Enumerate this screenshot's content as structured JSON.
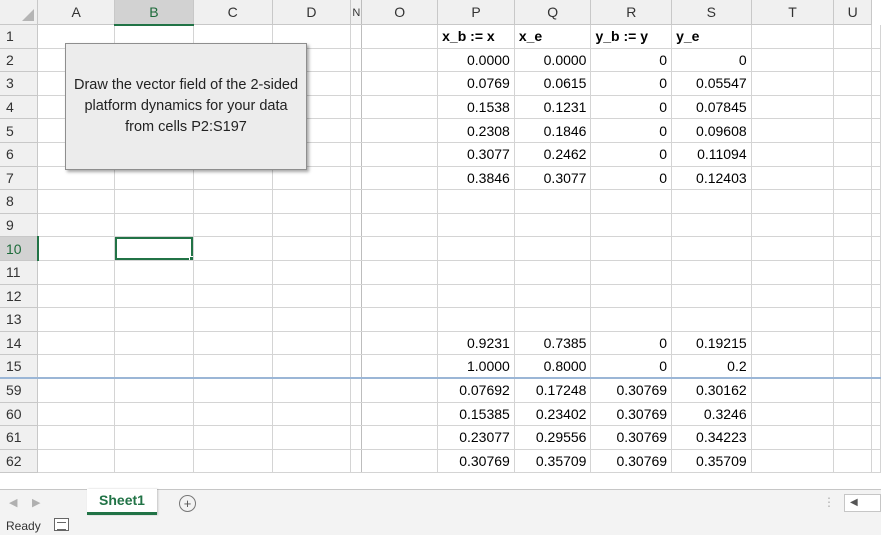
{
  "columns": [
    "A",
    "B",
    "C",
    "D",
    "N",
    "O",
    "P",
    "Q",
    "R",
    "S",
    "T",
    "U"
  ],
  "rows": [
    {
      "num": "1",
      "P": "x_b := x",
      "Q": "x_e",
      "R": "y_b := y",
      "S": "y_e",
      "header": true
    },
    {
      "num": "2",
      "P": "0.0000",
      "Q": "0.0000",
      "R": "0",
      "S": "0"
    },
    {
      "num": "3",
      "P": "0.0769",
      "Q": "0.0615",
      "R": "0",
      "S": "0.05547"
    },
    {
      "num": "4",
      "P": "0.1538",
      "Q": "0.1231",
      "R": "0",
      "S": "0.07845"
    },
    {
      "num": "5",
      "P": "0.2308",
      "Q": "0.1846",
      "R": "0",
      "S": "0.09608"
    },
    {
      "num": "6",
      "P": "0.3077",
      "Q": "0.2462",
      "R": "0",
      "S": "0.11094"
    },
    {
      "num": "7",
      "P": "0.3846",
      "Q": "0.3077",
      "R": "0",
      "S": "0.12403"
    },
    {
      "num": "8",
      "P": "",
      "Q": "",
      "R": "",
      "S": ""
    },
    {
      "num": "9",
      "P": "",
      "Q": "",
      "R": "",
      "S": ""
    },
    {
      "num": "10",
      "P": "",
      "Q": "",
      "R": "",
      "S": ""
    },
    {
      "num": "11",
      "P": "",
      "Q": "",
      "R": "",
      "S": ""
    },
    {
      "num": "12",
      "P": "",
      "Q": "",
      "R": "",
      "S": ""
    },
    {
      "num": "13",
      "P": "",
      "Q": "",
      "R": "",
      "S": ""
    },
    {
      "num": "14",
      "P": "0.9231",
      "Q": "0.7385",
      "R": "0",
      "S": "0.19215"
    },
    {
      "num": "15",
      "P": "1.0000",
      "Q": "0.8000",
      "R": "0",
      "S": "0.2"
    },
    {
      "num": "59",
      "P": "0.07692",
      "Q": "0.17248",
      "R": "0.30769",
      "S": "0.30162"
    },
    {
      "num": "60",
      "P": "0.15385",
      "Q": "0.23402",
      "R": "0.30769",
      "S": "0.3246"
    },
    {
      "num": "61",
      "P": "0.23077",
      "Q": "0.29556",
      "R": "0.30769",
      "S": "0.34223"
    },
    {
      "num": "62",
      "P": "0.30769",
      "Q": "0.35709",
      "R": "0.30769",
      "S": "0.35709"
    }
  ],
  "selected_cell": {
    "column": "B",
    "row": "10"
  },
  "textbox": {
    "text": "Draw the vector field of the 2-sided platform dynamics for your data from cells P2:S197"
  },
  "sheet_tabs": [
    {
      "label": "Sheet1",
      "active": true
    }
  ],
  "add_sheet_label": "+",
  "status": {
    "ready": "Ready"
  },
  "icons": [
    "prev-sheet-icon",
    "next-sheet-icon",
    "add-sheet-icon",
    "scroll-left-icon",
    "macro-record-icon"
  ],
  "colors": {
    "accent": "#217346",
    "header_bg": "#f0f0f0",
    "textbox_bg": "#ececec"
  }
}
